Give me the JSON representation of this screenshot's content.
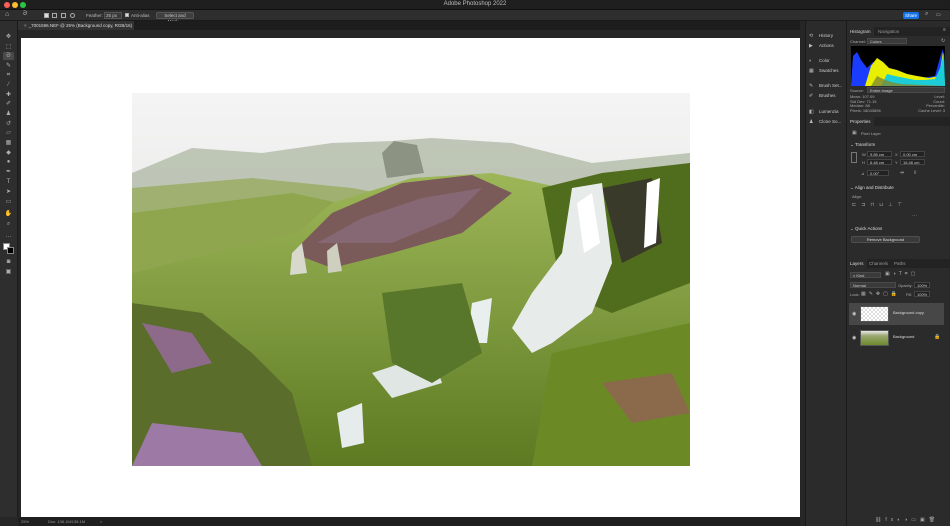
{
  "app": {
    "title": "Adobe Photoshop 2022"
  },
  "colors": {
    "accent": "#1473e6",
    "canvas": "#ffffff",
    "panel": "#2b2b2b",
    "histogram_yellow": "#e9ef00",
    "histogram_blue": "#1a3cff",
    "histogram_cyan": "#1ccdd8"
  },
  "options_bar": {
    "feather_label": "Feather:",
    "feather_value": "25 px",
    "antialias_label": "Anti-alias",
    "select_mask_label": "Select and Mask...",
    "share_label": "Share"
  },
  "document": {
    "tab_label": "_7001596.NEF @ 25% (Background copy, RGB/16) *",
    "close_icon": "×"
  },
  "toolbar": {
    "tools": [
      "move-icon",
      "marquee-icon",
      "lasso-icon",
      "quick-select-icon",
      "crop-icon",
      "eyedropper-icon",
      "healing-icon",
      "brush-icon",
      "stamp-icon",
      "history-brush-icon",
      "eraser-icon",
      "gradient-icon",
      "blur-icon",
      "dodge-icon",
      "pen-icon",
      "type-icon",
      "path-select-icon",
      "shape-icon",
      "hand-icon",
      "zoom-icon",
      "more-icon"
    ]
  },
  "status": {
    "zoom": "25%",
    "doc_info": "Doc: 138.1M/138.1M",
    "arrow": ">"
  },
  "icon_strip": {
    "items": [
      "History",
      "Actions",
      "Color",
      "Swatches",
      "Brush Set...",
      "Brushes",
      "Lumenzia",
      "Clone So..."
    ]
  },
  "histogram": {
    "tabs": [
      "Histogram",
      "Navigation"
    ],
    "channel_label": "Channel:",
    "channel_value": "Colors",
    "source_label": "Source:",
    "source_value": "Entire Image",
    "stats_left": [
      {
        "k": "Mean:",
        "v": "107.09"
      },
      {
        "k": "Std Dev:",
        "v": "71.15"
      },
      {
        "k": "Median:",
        "v": "88"
      },
      {
        "k": "Pixels:",
        "v": "18043896"
      }
    ],
    "stats_right": [
      {
        "k": "Level:",
        "v": ""
      },
      {
        "k": "Count:",
        "v": ""
      },
      {
        "k": "Percentile:",
        "v": ""
      },
      {
        "k": "Cache Level:",
        "v": "3"
      }
    ]
  },
  "properties": {
    "title": "Properties",
    "layer_type": "Pixel Layer",
    "transform_title": "Transform",
    "w_label": "W",
    "w_value": "9.85 cm",
    "x_label": "X",
    "x_value": "0.00 cm",
    "h_label": "H",
    "h_value": "6.48 cm",
    "y_label": "Y",
    "y_value": "16.46 cm",
    "angle_value": "0.00°",
    "align_title": "Align and Distribute",
    "align_label": "Align:",
    "quick_actions_title": "Quick Actions",
    "remove_bg_label": "Remove Background"
  },
  "layers": {
    "tabs": [
      "Layers",
      "Channels",
      "Paths"
    ],
    "kind_label": "Kind",
    "blend_mode": "Normal",
    "opacity_label": "Opacity:",
    "opacity_value": "100%",
    "lock_label": "Lock:",
    "fill_label": "Fill:",
    "fill_value": "100%",
    "items": [
      {
        "name": "Background copy"
      },
      {
        "name": "Background"
      }
    ]
  }
}
